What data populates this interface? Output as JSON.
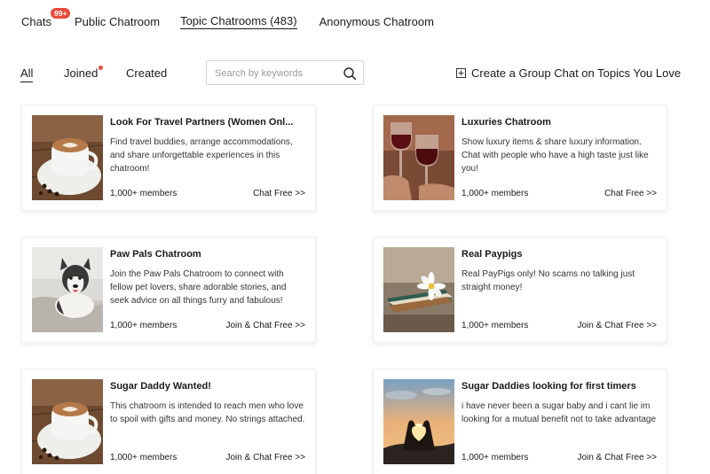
{
  "top_tabs": {
    "chats": "Chats",
    "chats_badge": "99+",
    "public": "Public Chatroom",
    "topic": "Topic Chatrooms (483)",
    "anonymous": "Anonymous Chatroom"
  },
  "filters": {
    "all": "All",
    "joined": "Joined",
    "created": "Created"
  },
  "search": {
    "placeholder": "Search by keywords"
  },
  "create_label": "Create a Group Chat on Topics You Love",
  "cards": [
    {
      "title": "Look For Travel Partners (Women Onl...",
      "description": "Find travel buddies, arrange accommodations, and share unforgettable experiences in this chatroom!",
      "members": "1,000+ members",
      "action": "Chat Free >>",
      "image": "latte-art-coffee"
    },
    {
      "title": "Luxuries Chatroom",
      "description": "Show luxury items & share luxury information. Chat with people who have a high taste just like you!",
      "members": "1,000+ members",
      "action": "Chat Free >>",
      "image": "red-wine-glasses"
    },
    {
      "title": "Paw Pals Chatroom",
      "description": "Join the Paw Pals Chatroom to connect with fellow pet lovers, share adorable stories, and seek advice on all things furry and fabulous!",
      "members": "1,000+ members",
      "action": "Join & Chat Free >>",
      "image": "husky-dog"
    },
    {
      "title": "Real Paypigs",
      "description": "Real PayPigs only! No scams no talking just straight money!",
      "members": "1,000+ members",
      "action": "Join & Chat Free >>",
      "image": "book-with-flower"
    },
    {
      "title": "Sugar Daddy Wanted!",
      "description": "This chatroom is intended to reach men who love to spoil with gifts and money. No strings attached.",
      "members": "1,000+ members",
      "action": "Join & Chat Free >>",
      "image": "latte-art-coffee"
    },
    {
      "title": "Sugar Daddies looking for first timers",
      "description": "i have never been a sugar baby and i cant lie im looking for a mutual benefit not to take advantage",
      "members": "1,000+ members",
      "action": "Join & Chat Free >>",
      "image": "heart-hands-sunset"
    }
  ],
  "colors": {
    "badge": "#e84a3c",
    "text": "#1a1a1a",
    "card_border": "#eeeeee"
  }
}
